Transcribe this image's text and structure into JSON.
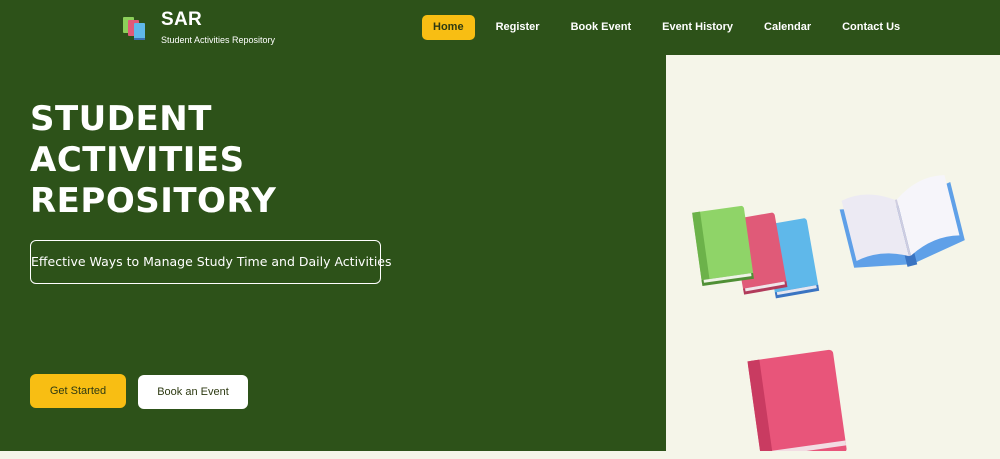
{
  "brand": {
    "title": "SAR",
    "subtitle": "Student Activities Repository",
    "logo_icon": "books-stack-icon"
  },
  "nav": {
    "items": [
      {
        "label": "Home",
        "active": true
      },
      {
        "label": "Register",
        "active": false
      },
      {
        "label": "Book Event",
        "active": false
      },
      {
        "label": "Event History",
        "active": false
      },
      {
        "label": "Calendar",
        "active": false
      },
      {
        "label": "Contact Us",
        "active": false
      }
    ]
  },
  "hero": {
    "title": "STUDENT ACTIVITIES REPOSITORY",
    "tagline": "Effective Ways to Manage Study Time and Daily Activities",
    "primary_button": "Get Started",
    "secondary_button": "Book an Event",
    "illustration_icons": [
      "books-stack-icon",
      "open-book-icon",
      "book-icon"
    ]
  },
  "colors": {
    "background": "#2d5219",
    "accent": "#f8be13",
    "panel": "#f5f5e9",
    "text_light": "#ffffff",
    "text_dark": "#2d3a12"
  }
}
